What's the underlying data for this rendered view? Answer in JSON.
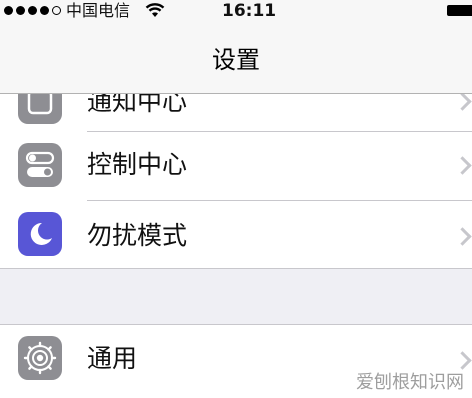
{
  "status_bar": {
    "carrier": "中国电信",
    "time": "16:11",
    "signal_bars_filled": 4,
    "signal_bars_total": 5
  },
  "nav": {
    "title": "设置"
  },
  "settings_group_1": [
    {
      "label": "通知中心",
      "icon": "notification-center-icon",
      "color": "#8e8e93"
    },
    {
      "label": "控制中心",
      "icon": "control-center-icon",
      "color": "#8e8e93"
    },
    {
      "label": "勿扰模式",
      "icon": "moon-icon",
      "color": "#5856d6"
    }
  ],
  "settings_group_2": [
    {
      "label": "通用",
      "icon": "gear-icon",
      "color": "#8e8e93"
    }
  ],
  "watermark": "爱刨根知识网"
}
